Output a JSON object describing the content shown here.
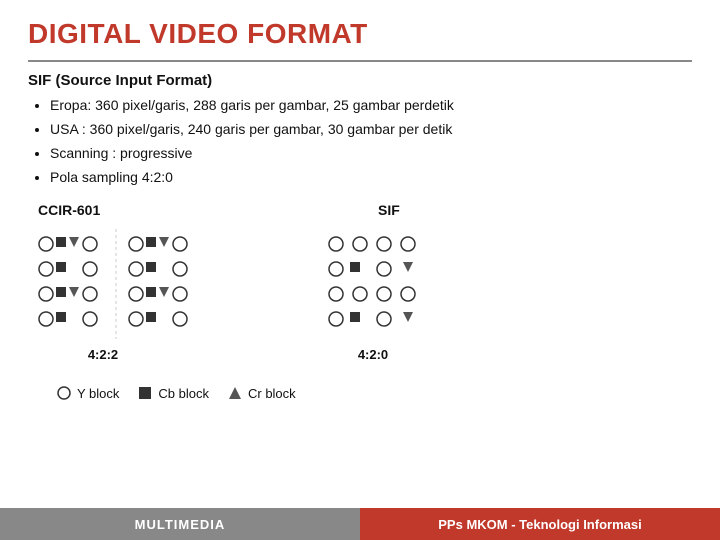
{
  "title": "DIGITAL VIDEO FORMAT",
  "section": {
    "subtitle": "SIF (Source Input Format)",
    "bullets": [
      "Eropa: 360 pixel/garis, 288 garis per gambar, 25 gambar perdetik",
      "USA : 360 pixel/garis, 240 garis per gambar, 30 gambar per detik",
      "Scanning : progressive",
      "Pola sampling 4:2:0"
    ]
  },
  "diagrams": {
    "ccir_label": "CCIR-601",
    "sif_label": "SIF",
    "ccir_ratio": "4:2:2",
    "sif_ratio": "4:2:0"
  },
  "legend": {
    "items": [
      {
        "symbol": "Y block",
        "type": "circle"
      },
      {
        "symbol": "Cb block",
        "type": "square"
      },
      {
        "symbol": "Cr block",
        "type": "triangle"
      }
    ]
  },
  "footer": {
    "left": "MULTIMEDIA",
    "right": "PPs MKOM - Teknologi Informasi"
  }
}
